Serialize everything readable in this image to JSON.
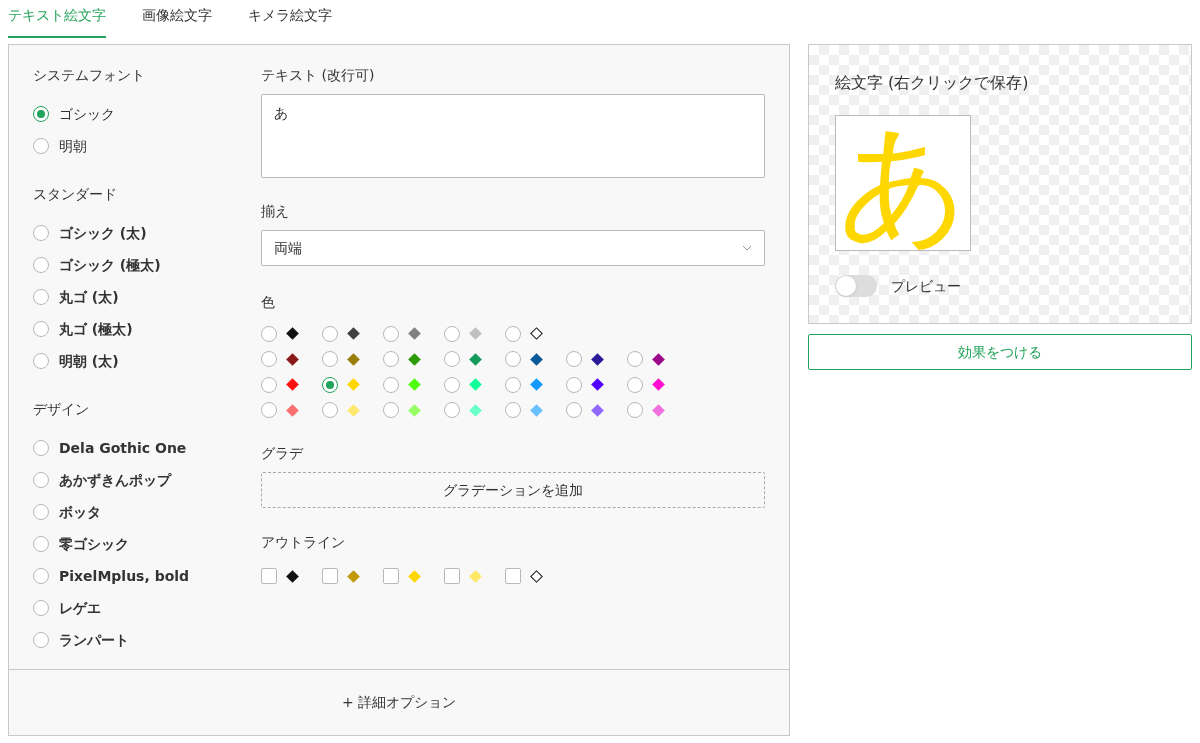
{
  "tabs": [
    {
      "label": "テキスト絵文字",
      "selected": true
    },
    {
      "label": "画像絵文字",
      "selected": false
    },
    {
      "label": "キメラ絵文字",
      "selected": false
    }
  ],
  "font_groups": [
    {
      "heading": "システムフォント",
      "kind": "system",
      "options": [
        {
          "label": "ゴシック",
          "selected": true
        },
        {
          "label": "明朝",
          "selected": false
        }
      ]
    },
    {
      "heading": "スタンダード",
      "kind": "styled",
      "options": [
        {
          "label": "ゴシック (太)",
          "selected": false
        },
        {
          "label": "ゴシック (極太)",
          "selected": false
        },
        {
          "label": "丸ゴ (太)",
          "selected": false
        },
        {
          "label": "丸ゴ (極太)",
          "selected": false
        },
        {
          "label": "明朝 (太)",
          "selected": false
        }
      ]
    },
    {
      "heading": "デザイン",
      "kind": "styled",
      "options": [
        {
          "label": "Dela Gothic One",
          "selected": false
        },
        {
          "label": "あかずきんポップ",
          "selected": false
        },
        {
          "label": "ボッタ",
          "selected": false
        },
        {
          "label": "零ゴシック",
          "selected": false
        },
        {
          "label": "PixelMplus, bold",
          "selected": false
        },
        {
          "label": "レゲエ",
          "selected": false
        },
        {
          "label": "ランパート",
          "selected": false
        }
      ]
    }
  ],
  "text": {
    "label": "テキスト (改行可)",
    "value": "あ"
  },
  "align": {
    "label": "揃え",
    "value": "両端"
  },
  "color": {
    "label": "色",
    "rows": [
      [
        {
          "color": "#111111",
          "selected": false
        },
        {
          "color": "#404040",
          "selected": false
        },
        {
          "color": "#808080",
          "selected": false
        },
        {
          "color": "#c0c0c0",
          "selected": false
        },
        {
          "color": "#ffffff",
          "selected": false
        }
      ],
      [
        {
          "color": "#8b1a1a",
          "selected": false
        },
        {
          "color": "#9a7d0a",
          "selected": false
        },
        {
          "color": "#2e9a0a",
          "selected": false
        },
        {
          "color": "#129a5a",
          "selected": false
        },
        {
          "color": "#0a5a9a",
          "selected": false
        },
        {
          "color": "#2a1a9a",
          "selected": false
        },
        {
          "color": "#9a0a8a",
          "selected": false
        }
      ],
      [
        {
          "color": "#ff1010",
          "selected": false
        },
        {
          "color": "#ffd700",
          "selected": true
        },
        {
          "color": "#50ff10",
          "selected": false
        },
        {
          "color": "#10ff9a",
          "selected": false
        },
        {
          "color": "#109aff",
          "selected": false
        },
        {
          "color": "#5000ff",
          "selected": false
        },
        {
          "color": "#ff10d0",
          "selected": false
        }
      ],
      [
        {
          "color": "#f87070",
          "selected": false
        },
        {
          "color": "#ffe870",
          "selected": false
        },
        {
          "color": "#98ff68",
          "selected": false
        },
        {
          "color": "#68ffc8",
          "selected": false
        },
        {
          "color": "#68c0ff",
          "selected": false
        },
        {
          "color": "#9068ff",
          "selected": false
        },
        {
          "color": "#f070e0",
          "selected": false
        }
      ]
    ]
  },
  "gradient": {
    "label": "グラデ",
    "button": "グラデーションを追加"
  },
  "outline": {
    "label": "アウトライン",
    "swatches": [
      {
        "color": "#111111",
        "checked": false
      },
      {
        "color": "#c09a0a",
        "checked": false
      },
      {
        "color": "#ffd700",
        "checked": false
      },
      {
        "color": "#ffe868",
        "checked": false
      },
      {
        "color": "#ffffff",
        "checked": false
      }
    ]
  },
  "details_button": "+ 詳細オプション",
  "preview": {
    "title": "絵文字 (右クリックで保存)",
    "glyph": "あ",
    "color": "#ffd700",
    "toggle_label": "プレビュー",
    "toggle_on": false
  },
  "effect_button": "効果をつける"
}
